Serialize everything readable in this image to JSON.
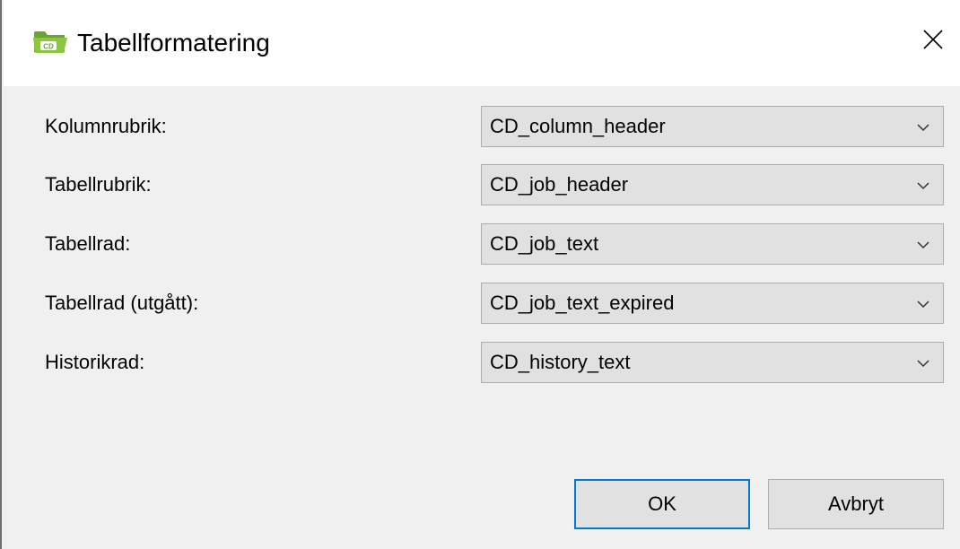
{
  "dialog": {
    "title": "Tabellformatering",
    "app_icon": "folder-cd-icon",
    "close_icon": "close-icon"
  },
  "rows": [
    {
      "label": "Kolumnrubrik:",
      "value": "CD_column_header"
    },
    {
      "label": "Tabellrubrik:",
      "value": "CD_job_header"
    },
    {
      "label": "Tabellrad:",
      "value": "CD_job_text"
    },
    {
      "label": "Tabellrad (utgått):",
      "value": "CD_job_text_expired"
    },
    {
      "label": "Historikrad:",
      "value": "CD_history_text"
    }
  ],
  "buttons": {
    "ok_label": "OK",
    "cancel_label": "Avbryt"
  },
  "colors": {
    "accent": "#0078d7",
    "icon_folder": "#8dc63f",
    "window_bg": "#f0f0f0",
    "titlebar_bg": "#ffffff"
  }
}
